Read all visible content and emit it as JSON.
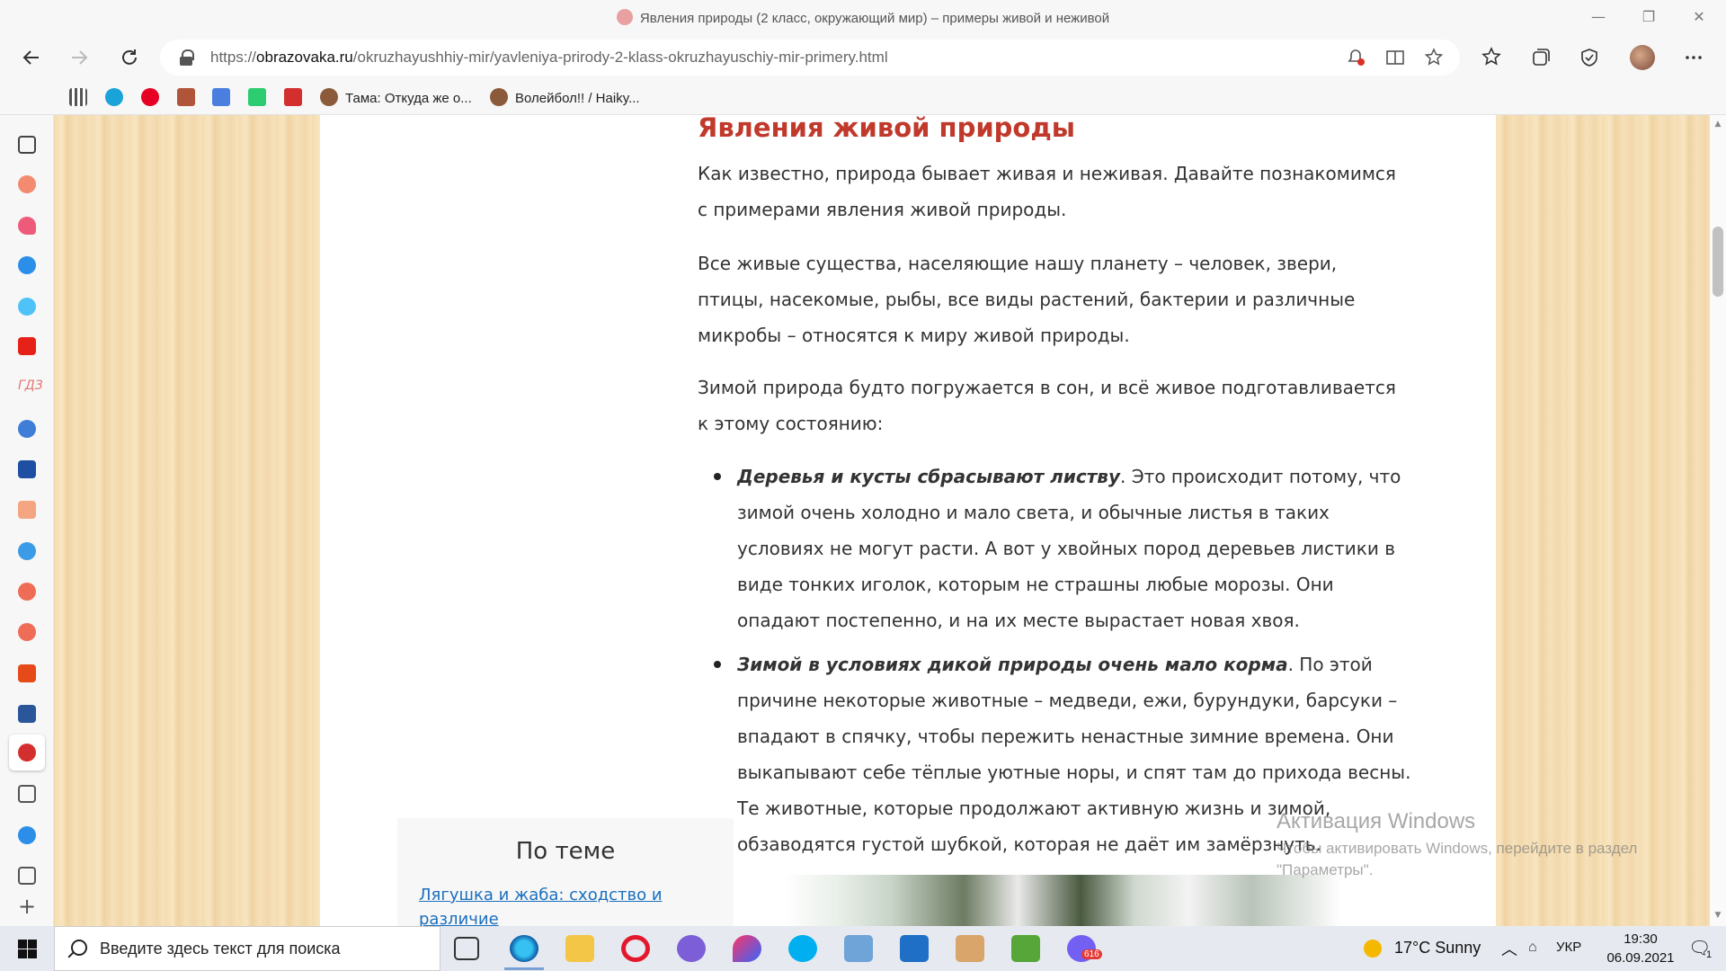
{
  "window": {
    "title": "Явления природы (2 класс, окружающий мир) – примеры живой и неживой",
    "minimize_glyph": "—",
    "restore_glyph": "❐",
    "close_glyph": "✕"
  },
  "address_bar": {
    "url_prefix": "https://",
    "url_host": "obrazovaka.ru",
    "url_path": "/okruzhayushhiy-mir/yavleniya-prirody-2-klass-okruzhayuschiy-mir-primery.html"
  },
  "bookmarks": [
    {
      "label": "Тама: Откуда же о...",
      "icon": "anime-icon"
    },
    {
      "label": "Волейбол!! / Haiky...",
      "icon": "anime-icon"
    }
  ],
  "article": {
    "heading": "Явления живой природы",
    "paragraphs": [
      "Как известно, природа бывает живая и неживая. Давайте познакомимся с примерами явления живой природы.",
      "Все живые существа, населяющие нашу планету – человек, звери, птицы, насекомые, рыбы, все виды растений, бактерии и различные микробы – относятся к миру живой природы.",
      "Зимой природа будто погружается в сон, и всё живое подготавливается к этому состоянию:"
    ],
    "bullets": [
      {
        "bold": "Деревья и кусты сбрасывают листву",
        "text": ".   Это происходит потому, что зимой очень холодно и мало света, и обычные листья в таких условиях не могут расти. А вот у хвойных пород деревьев листики в виде тонких иголок, которым не страшны любые морозы. Они опадают постепенно, и на их месте вырастает новая хвоя."
      },
      {
        "bold": "Зимой в условиях дикой природы очень мало корма",
        "text": ". По этой причине некоторые животные – медведи, ежи, бурундуки, барсуки – впадают в спячку, чтобы пережить ненастные зимние времена. Они выкапывают себе тёплые уютные норы, и спят там до прихода весны. Те животные, которые продолжают активную жизнь и зимой, обзаводятся густой шубкой, которая не даёт им замёрзнуть."
      }
    ]
  },
  "related": {
    "heading": "По теме",
    "link": "Лягушка и жаба: сходство и различие"
  },
  "watermark": {
    "title": "Активация Windows",
    "text": "Чтобы активировать Windows, перейдите в раздел \"Параметры\"."
  },
  "taskbar": {
    "search_placeholder": "Введите здесь текст для поиска",
    "weather": "17°C  Sunny",
    "language": "УКР",
    "time": "19:30",
    "date": "06.09.2021",
    "notification_count": "1",
    "viber_badge": "616"
  },
  "colors": {
    "heading": "#c0392b",
    "link": "#1a6fbf",
    "wood_background": "#f4dcb0"
  }
}
